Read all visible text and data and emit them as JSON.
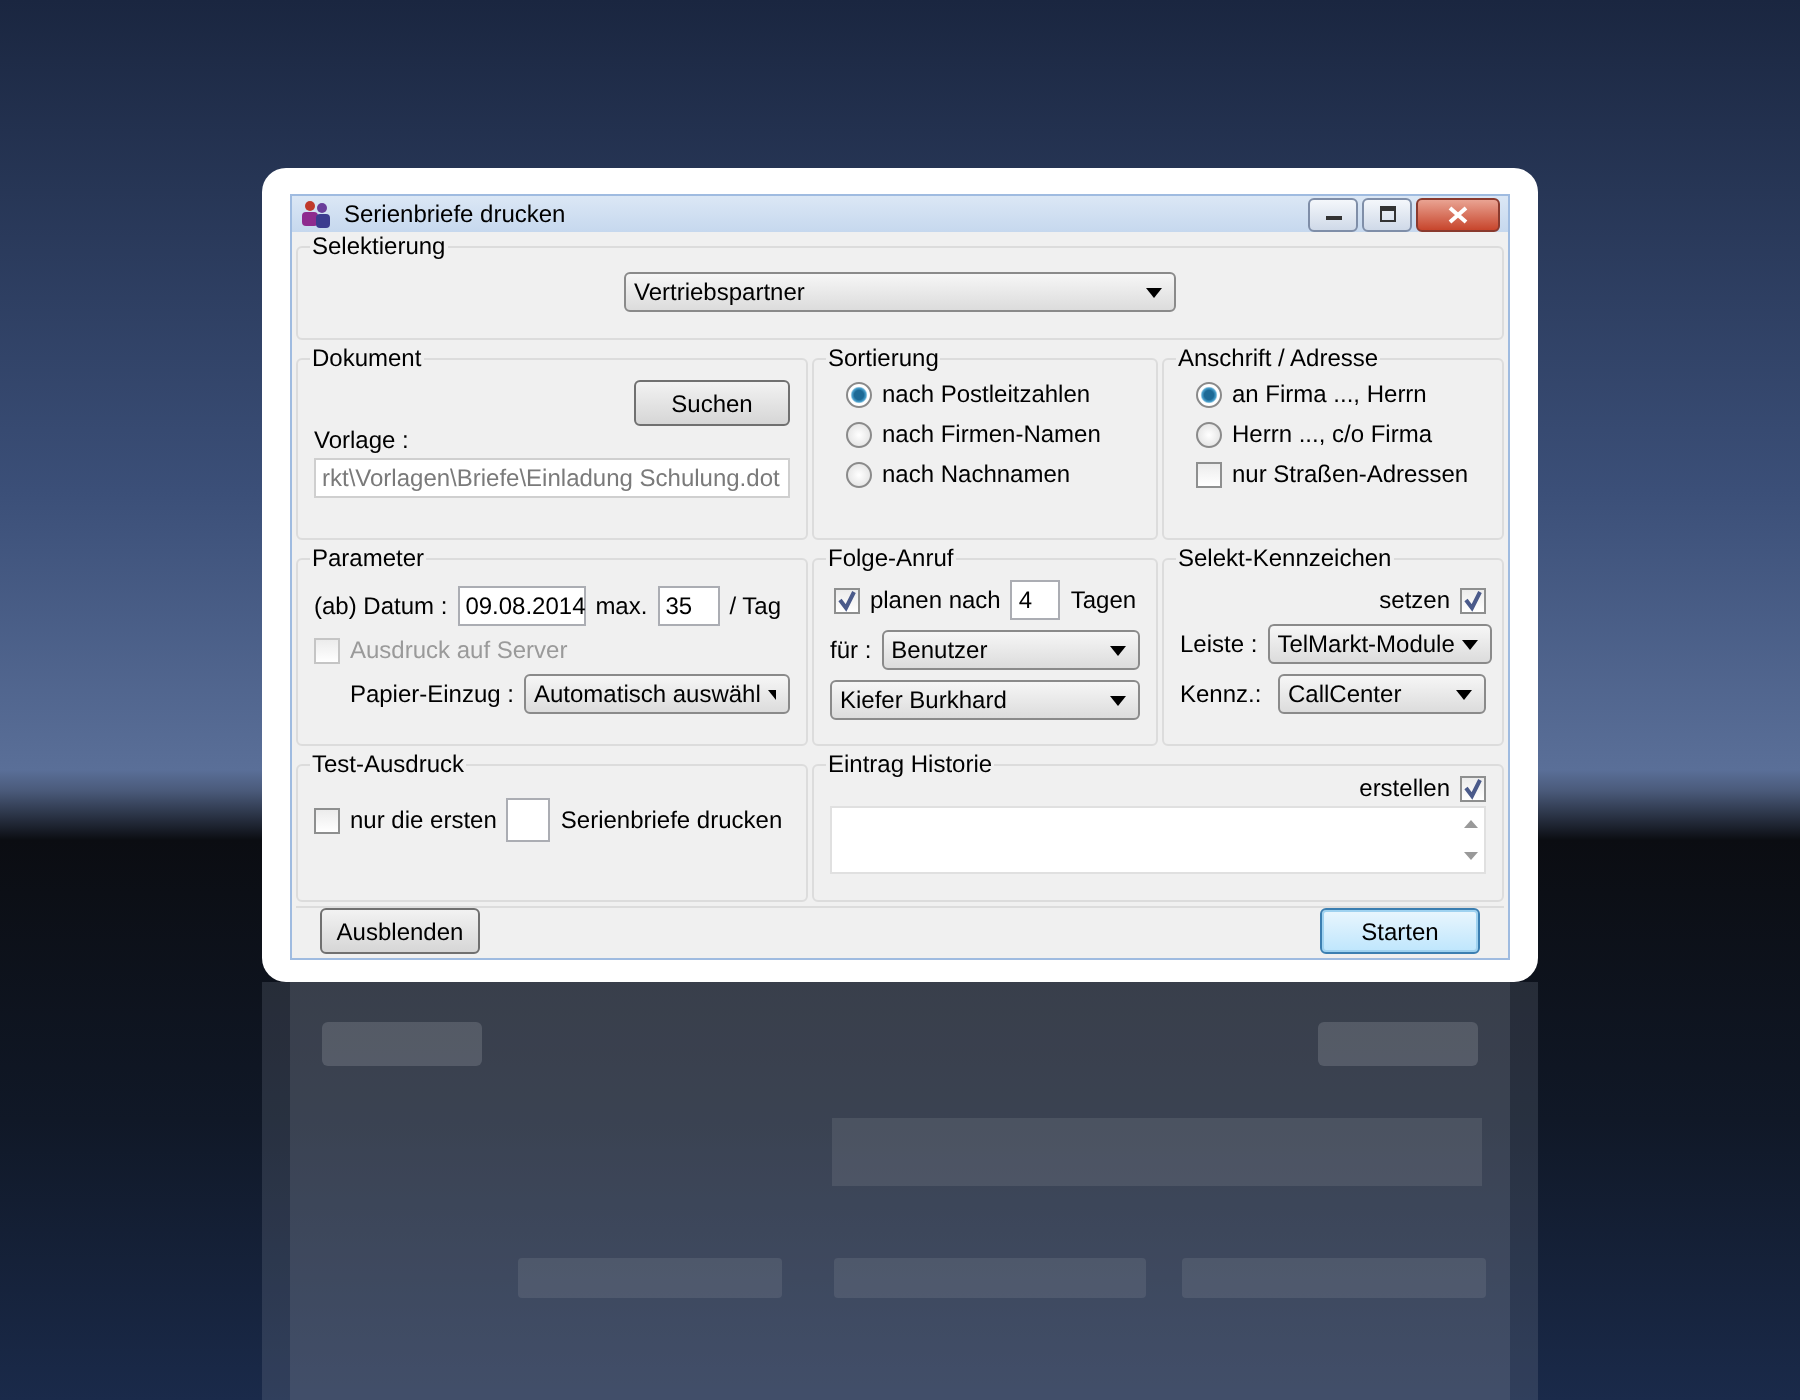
{
  "window": {
    "title": "Serienbriefe drucken"
  },
  "selektierung": {
    "label": "Selektierung",
    "value": "Vertriebspartner"
  },
  "dokument": {
    "label": "Dokument",
    "button": "Suchen",
    "vorlage_label": "Vorlage :",
    "vorlage_value": "rkt\\Vorlagen\\Briefe\\Einladung Schulung.dot",
    "vorlage_disabled": true
  },
  "sortierung": {
    "label": "Sortierung",
    "options": [
      {
        "label": "nach Postleitzahlen",
        "selected": true
      },
      {
        "label": "nach Firmen-Namen",
        "selected": false
      },
      {
        "label": "nach Nachnamen",
        "selected": false
      }
    ]
  },
  "anschrift": {
    "label": "Anschrift / Adresse",
    "options": [
      {
        "label": "an Firma ..., Herrn",
        "selected": true
      },
      {
        "label": "Herrn ..., c/o Firma",
        "selected": false
      }
    ],
    "checkbox": {
      "label": "nur Straßen-Adressen",
      "checked": false
    }
  },
  "parameter": {
    "label": "Parameter",
    "datum_label": "(ab) Datum :",
    "datum_value": "09.08.2014",
    "max_label": "max.",
    "max_value": "35",
    "per_label": "/ Tag",
    "server": {
      "label": "Ausdruck auf Server",
      "checked": false,
      "disabled": true
    },
    "papier_label": "Papier-Einzug :",
    "papier_value": "Automatisch auswähl"
  },
  "folge_anruf": {
    "label": "Folge-Anruf",
    "plan": {
      "label": "planen nach",
      "checked": true
    },
    "days_value": "4",
    "days_unit": "Tagen",
    "fuer_label": "für :",
    "fuer_value": "Benutzer",
    "user_value": "Kiefer Burkhard"
  },
  "selekt_kennzeichen": {
    "label": "Selekt-Kennzeichen",
    "setzen": {
      "label": "setzen",
      "checked": true
    },
    "leiste_label": "Leiste :",
    "leiste_value": "TelMarkt-Module",
    "kennz_label": "Kennz.:",
    "kennz_value": "CallCenter"
  },
  "test_ausdruck": {
    "label": "Test-Ausdruck",
    "checkbox": {
      "label": "nur die ersten",
      "checked": false
    },
    "suffix": "Serienbriefe drucken"
  },
  "eintrag_historie": {
    "label": "Eintrag Historie",
    "erstellen": {
      "label": "erstellen",
      "checked": true
    }
  },
  "buttons": [
    {
      "label": "Ausblenden",
      "default": false
    },
    {
      "label": "Starten",
      "default": true
    }
  ]
}
